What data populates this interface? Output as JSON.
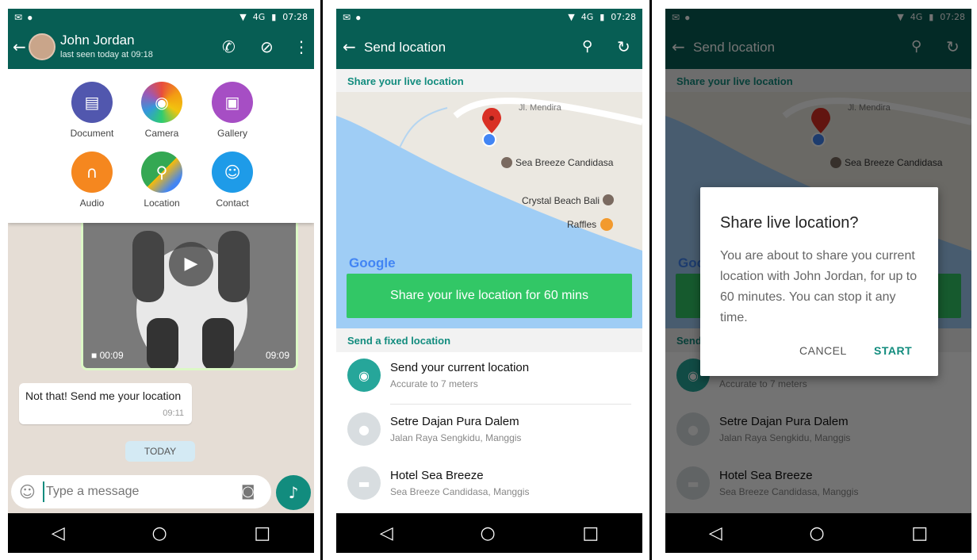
{
  "status": {
    "time": "07:28",
    "network": "4G"
  },
  "chat": {
    "contact_name": "John Jordan",
    "last_seen": "last seen today at 09:18",
    "attach_items": [
      "Document",
      "Camera",
      "Gallery",
      "Audio",
      "Location",
      "Contact"
    ],
    "video_duration": "00:09",
    "video_time": "09:09",
    "message_text": "Not that! Send me your location",
    "message_time": "09:11",
    "date_chip": "TODAY",
    "input_placeholder": "Type a message"
  },
  "send_location": {
    "title": "Send location",
    "live_section": "Share your live location",
    "map_places": [
      "Jl. Mendira",
      "Sea Breeze Candidasa",
      "Crystal Beach Bali",
      "Raffles"
    ],
    "map_logo": "Google",
    "share_button": "Share your live location for 60 mins",
    "fixed_section": "Send a fixed location",
    "locations": [
      {
        "title": "Send your current location",
        "subtitle": "Accurate to 7 meters"
      },
      {
        "title": "Setre Dajan Pura Dalem",
        "subtitle": "Jalan Raya Sengkidu, Manggis"
      },
      {
        "title": "Hotel Sea Breeze",
        "subtitle": "Sea Breeze Candidasa, Manggis"
      }
    ]
  },
  "dialog": {
    "title": "Share live location?",
    "body": "You are about to share you current location with John Jordan, for up to 60 minutes. You can stop it any time.",
    "cancel": "CANCEL",
    "start": "START"
  },
  "colors": {
    "primary": "#075e54",
    "accent": "#128c7e",
    "share_green": "#32c766"
  }
}
